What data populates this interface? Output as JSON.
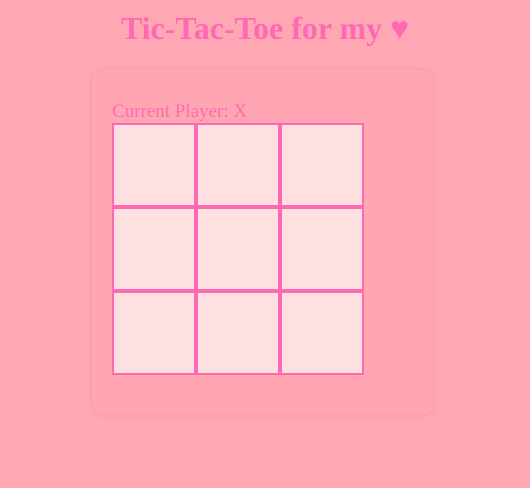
{
  "header": {
    "title": "Tic-Tac-Toe for my",
    "heart_glyph": "♥"
  },
  "game": {
    "status_text": "Current Player: X",
    "board": [
      [
        "",
        "",
        ""
      ],
      [
        "",
        "",
        ""
      ],
      [
        "",
        "",
        ""
      ]
    ]
  },
  "colors": {
    "page_background": "#ffa8b4",
    "accent": "#ff69b4",
    "cell_background": "#ffe0e0"
  }
}
